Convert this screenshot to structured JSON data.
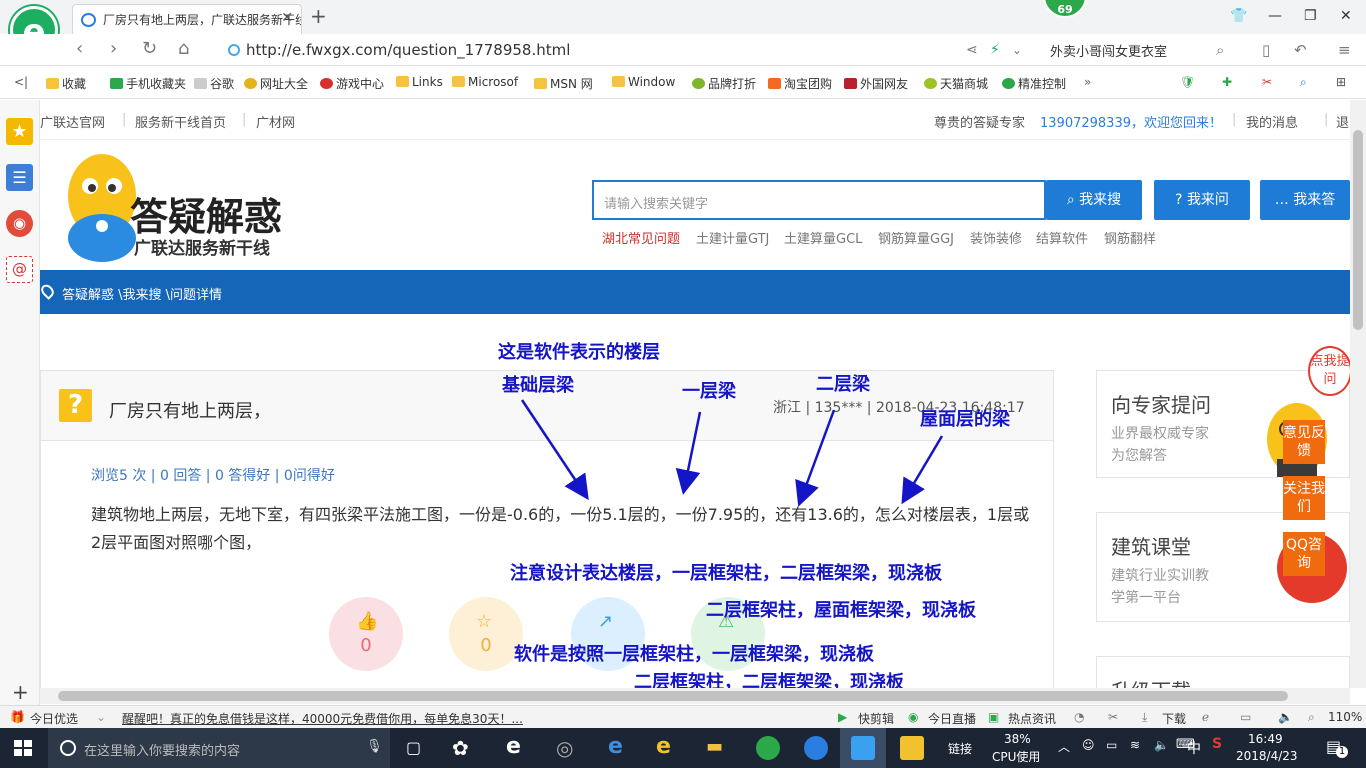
{
  "browser": {
    "logo_letter": "e",
    "tab_title": "厂房只有地上两层，广联达服务新干线",
    "badge_count": "69",
    "url": "http://e.fwxgx.com/question_1778958.html",
    "search_text": "外卖小哥闯女更衣室"
  },
  "bookmarks": [
    "收藏",
    "手机收藏夹",
    "谷歌",
    "网址大全",
    "游戏中心",
    "Links",
    "Microsof",
    "MSN 网",
    "Window",
    "品牌打折",
    "淘宝团购",
    "外国网友",
    "天猫商城",
    "精准控制"
  ],
  "site": {
    "topnav": [
      "广联达官网",
      "服务新干线首页",
      "广材网"
    ],
    "welcome_label": "尊贵的答疑专家",
    "user_welcome": "13907298339，欢迎您回来！",
    "my_messages": "我的消息",
    "logout": "退出",
    "logo_title": "答疑解惑",
    "logo_subtitle": "广联达服务新干线",
    "search_placeholder": "请输入搜索关键字",
    "btn_search": "我来搜",
    "btn_ask": "我来问",
    "btn_answer": "我来答",
    "hot_links": [
      "湖北常见问题",
      "土建计量GTJ",
      "土建算量GCL",
      "钢筋算量GGJ",
      "装饰装修",
      "结算软件",
      "钢筋翻样"
    ],
    "breadcrumb": "答疑解惑 \\我来搜 \\问题详情"
  },
  "question": {
    "title": "厂房只有地上两层，",
    "meta": "浙江 | 135*** | 2018-04-23 16:48:17",
    "stats": "浏览5 次 | 0 回答 | 0 答得好 | 0问得好",
    "body": "建筑物地上两层，无地下室，有四张梁平法施工图，一份是-0.6的，一份5.1层的，一份7.95的，还有13.6的，怎么对楼层表，1层或2层平面图对照哪个图，",
    "like_count": "0",
    "fav_count": "0"
  },
  "right": {
    "ask_title": "向专家提问",
    "ask_sub1": "业界最权威专家",
    "ask_sub2": "为您解答",
    "course_title": "建筑课堂",
    "course_sub1": "建筑行业实训教",
    "course_sub2": "学第一平台",
    "upgrade_title": "升级下载",
    "tab_feedback": "意见反馈",
    "tab_follow": "关注我们",
    "tab_qq": "QQ咨询",
    "bubble": "点我提问"
  },
  "annotations": {
    "a1": "这是软件表示的楼层",
    "a2": "基础层梁",
    "a3": "一层梁",
    "a4": "二层梁",
    "a5": "屋面层的梁",
    "a6": "注意设计表达楼层，一层框架柱，二层框架梁，现浇板",
    "a7": "二层框架柱，屋面框架梁，现浇板",
    "a8": "软件是按照一层框架柱，一层框架梁，现浇板",
    "a9": "二层框架柱，二层框架梁，现浇板"
  },
  "statusbar": {
    "today": "今日优选",
    "news": "醒醒吧！真正的免息借钱是这样，40000元免费借你用，每单免息30天！...",
    "clip": "快剪辑",
    "live": "今日直播",
    "hot": "热点资讯",
    "download": "下载",
    "zoom": "110%"
  },
  "taskbar": {
    "search_placeholder": "在这里输入你要搜索的内容",
    "link_label": "链接",
    "cpu_percent": "38%",
    "cpu_label": "CPU使用",
    "ime": "中",
    "time": "16:49",
    "date": "2018/4/23",
    "notif_count": "1"
  },
  "colors": {
    "accent_blue": "#1e7bd6",
    "crumb_bar": "#1565b8",
    "annotation": "#1515c8",
    "orange_tab": "#f06a0e"
  }
}
